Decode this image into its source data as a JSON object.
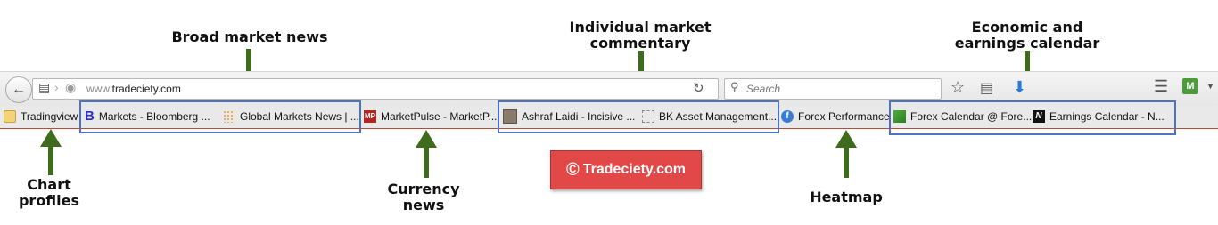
{
  "annotations": {
    "broad": "Broad market news",
    "individual_line1": "Individual market",
    "individual_line2": "commentary",
    "economic_line1": "Economic and",
    "economic_line2": "earnings calendar",
    "chart_line1": "Chart",
    "chart_line2": "profiles",
    "currency_line1": "Currency",
    "currency_line2": "news",
    "heatmap": "Heatmap"
  },
  "toolbar": {
    "url_prefix": "www.",
    "url_domain": "tradeciety.com",
    "search_placeholder": "Search"
  },
  "bookmarks": {
    "tradingview": "Tradingview",
    "bloomberg": "Markets - Bloomberg ...",
    "global": "Global Markets News | ...",
    "marketpulse": "MarketPulse - MarketP...",
    "ashraf": "Ashraf Laidi - Incisive ...",
    "bk": "BK Asset Management...",
    "forex_perf": "Forex Performance",
    "forex_cal": "Forex Calendar @ Fore...",
    "earnings": "Earnings Calendar - N..."
  },
  "watermark": {
    "symbol": "©",
    "text": "Tradeciety.com"
  },
  "colors": {
    "arrow": "#3f6b1e",
    "highlight": "#4a73c4",
    "watermark_bg": "#e34848"
  }
}
